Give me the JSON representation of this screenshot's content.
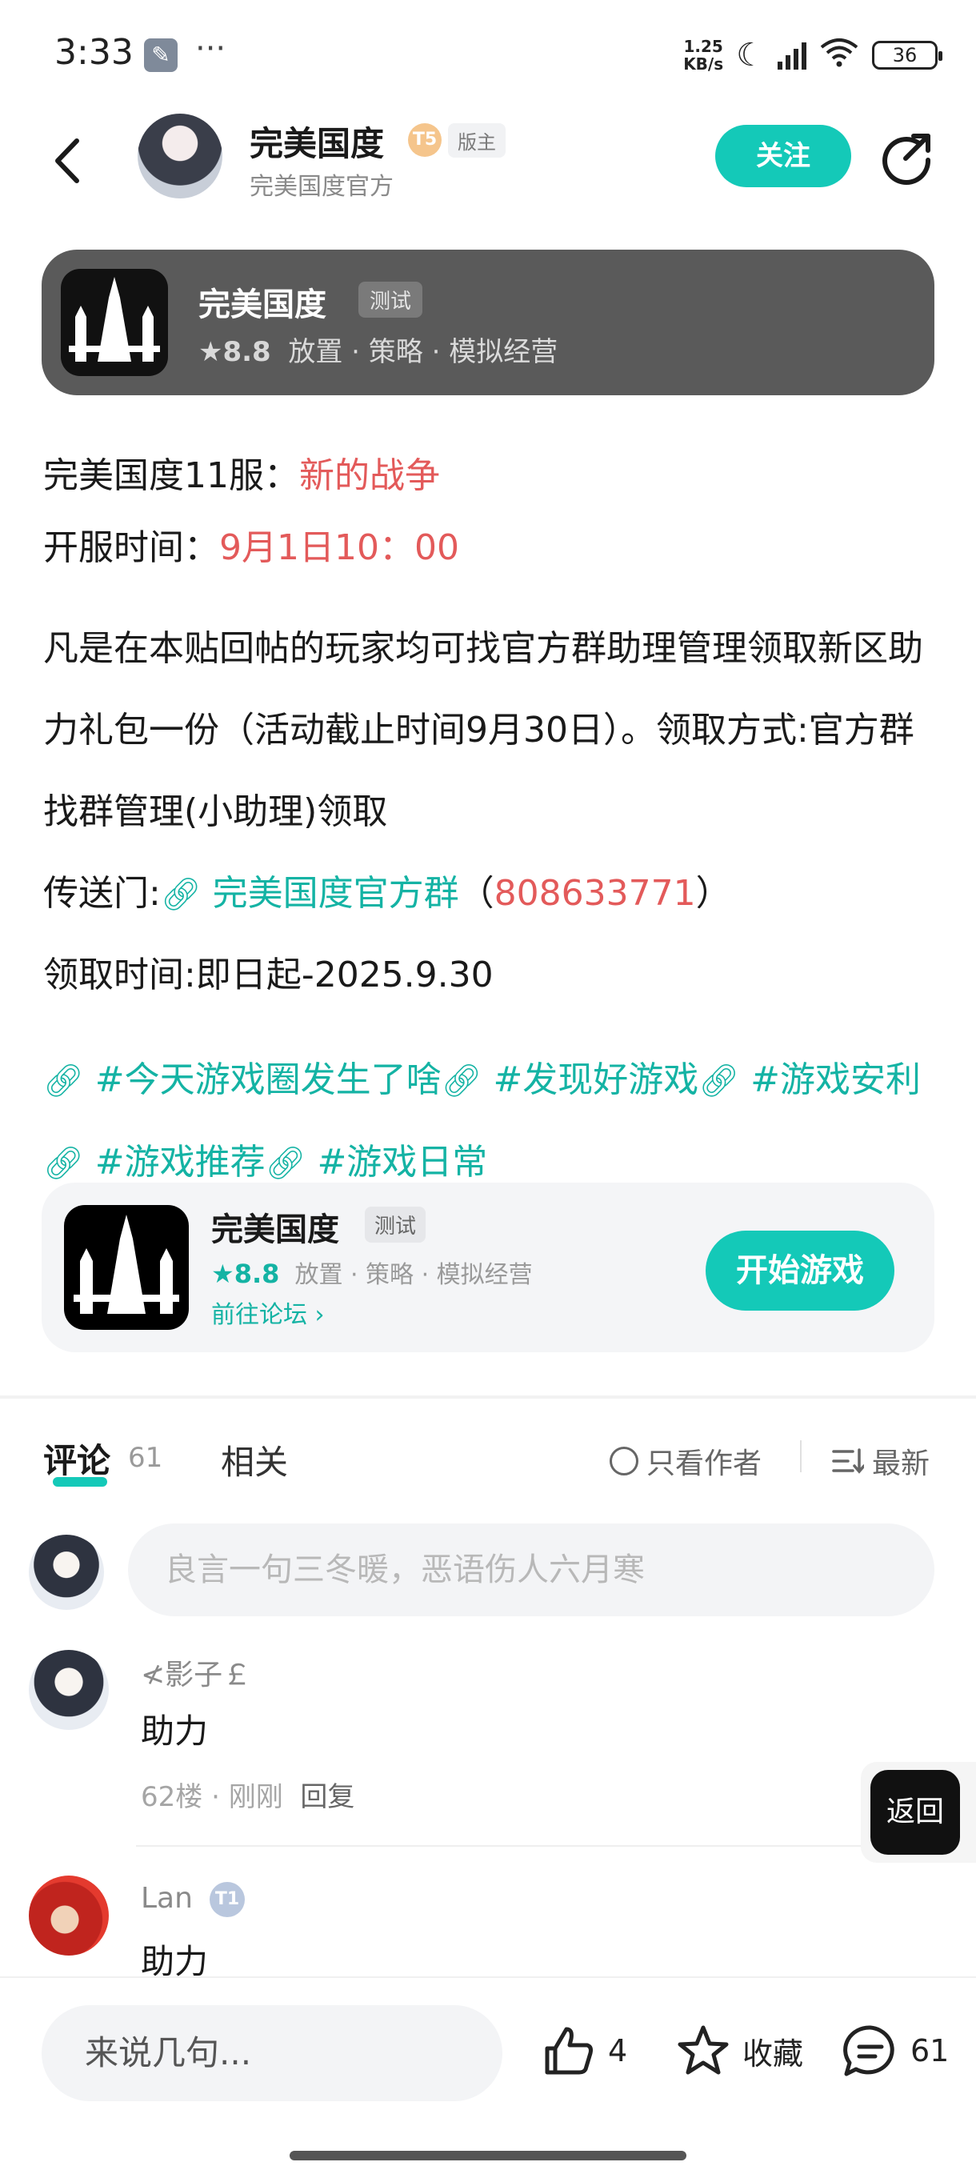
{
  "status_bar": {
    "time": "3:33",
    "dots": "···",
    "speed_top": "1.25",
    "speed_bottom": "KB/s",
    "battery": "36"
  },
  "header": {
    "author_name": "完美国度",
    "level_badge": "T5",
    "role_badge": "版主",
    "author_sub": "完美国度官方",
    "follow_label": "关注"
  },
  "game_banner": {
    "name": "完美国度",
    "tag": "测试",
    "rating": "8.8",
    "genres": "放置 · 策略 · 模拟经营"
  },
  "post": {
    "line1_label": "完美国度11服：",
    "line1_value": "新的战争",
    "line2_label": "开服时间：",
    "line2_value": "9月1日10：00",
    "para1": "凡是在本贴回帖的玩家均可找官方群助理管理领取新区助力礼包一份（活动截止时间9月30日）。领取方式:官方群找群管理(小助理)领取",
    "portal_label": "传送门:",
    "portal_link": "完美国度官方群",
    "portal_paren_open": "（",
    "portal_number": "808633771",
    "portal_paren_close": "）",
    "claim_time": "领取时间:即日起-2025.9.30",
    "tags": [
      "#今天游戏圈发生了啥",
      "#发现好游戏",
      "#游戏安利",
      "#游戏推荐",
      "#游戏日常"
    ]
  },
  "game_card": {
    "name": "完美国度",
    "tag": "测试",
    "rating": "8.8",
    "genres": "放置 · 策略 · 模拟经营",
    "forum_link": "前往论坛",
    "play_label": "开始游戏"
  },
  "comments_section": {
    "tab_comments": "评论",
    "comment_count": "61",
    "tab_related": "相关",
    "only_author": "只看作者",
    "sort": "最新",
    "input_placeholder": "良言一句三冬暖，恶语伤人六月寒",
    "items": [
      {
        "name": "≮影子￡",
        "text": "助力",
        "floor": "62楼",
        "time": "刚刚",
        "reply": "回复"
      },
      {
        "name": "Lan",
        "badge": "T1",
        "text": "助力"
      }
    ]
  },
  "float_return": {
    "label": "返回"
  },
  "bottom_bar": {
    "input_placeholder": "来说几句...",
    "likes": "4",
    "favorite_label": "收藏",
    "comments": "61"
  },
  "colors": {
    "accent": "#14c9b8",
    "red": "#e35a5a",
    "link": "#14b3a4"
  }
}
